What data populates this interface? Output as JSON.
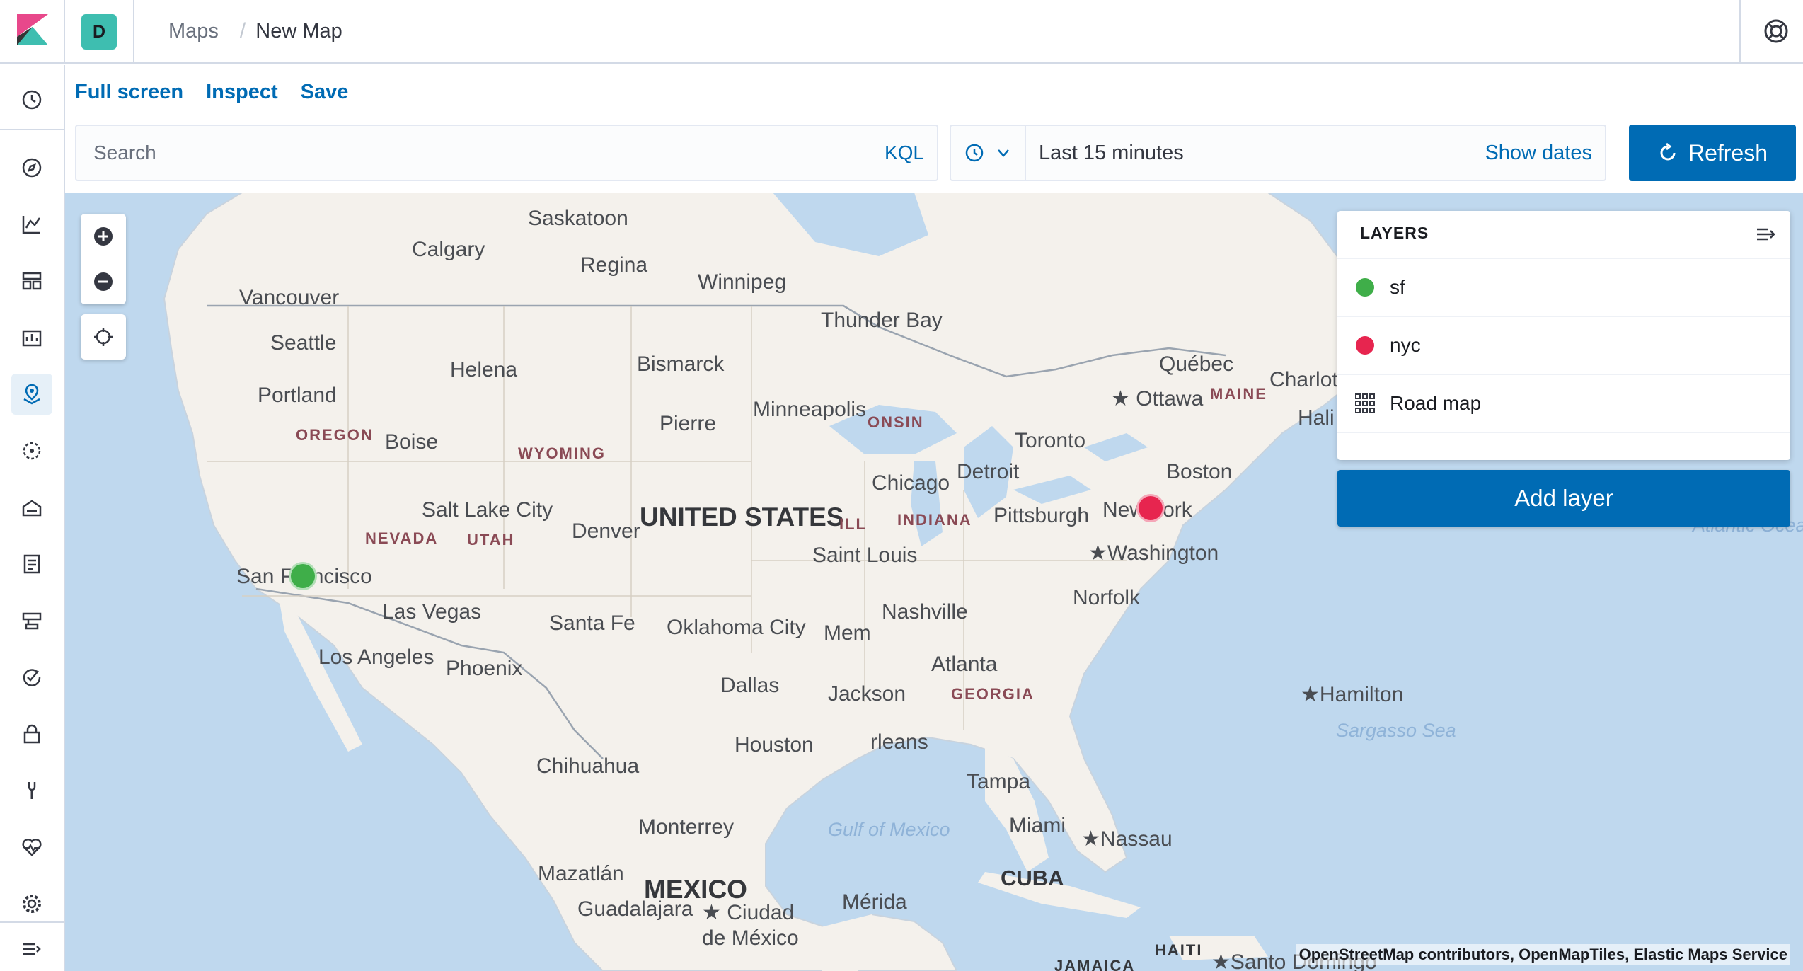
{
  "header": {
    "space_initial": "D",
    "breadcrumbs": [
      "Maps",
      "New Map"
    ],
    "breadcrumb_separator": "/"
  },
  "sidenav": {
    "items": [
      "clock-icon",
      "compass-icon",
      "visualize-icon",
      "dashboard-icon",
      "canvas-icon",
      "maps-icon",
      "ml-icon",
      "infra-icon",
      "logs-icon",
      "apm-icon",
      "uptime-icon",
      "security-icon",
      "devtools-icon",
      "monitoring-icon",
      "management-icon"
    ],
    "active_item": "maps-icon"
  },
  "topnav": {
    "full_screen": "Full screen",
    "inspect": "Inspect",
    "save": "Save"
  },
  "query": {
    "placeholder": "Search",
    "language": "KQL"
  },
  "date_picker": {
    "value": "Last 15 minutes",
    "show_dates": "Show dates"
  },
  "refresh_button": {
    "label": "Refresh"
  },
  "layers": {
    "title": "LAYERS",
    "items": [
      {
        "name": "sf",
        "color": "#3fae49",
        "icon": "circle-dot"
      },
      {
        "name": "nyc",
        "color": "#e7254f",
        "icon": "circle-dot"
      },
      {
        "name": "Road map",
        "color": "#343741",
        "icon": "grid-icon"
      }
    ],
    "add_label": "Add layer"
  },
  "map": {
    "labels": {
      "saskatoon": "Saskatoon",
      "calgary": "Calgary",
      "regina": "Regina",
      "winnipeg": "Winnipeg",
      "vancouver": "Vancouver",
      "thunder_bay": "Thunder Bay",
      "seattle": "Seattle",
      "helena": "Helena",
      "bismarck": "Bismarck",
      "quebec": "Québec",
      "charlo": "Charlot",
      "ottawa": "Ottawa",
      "maine": "MAINE",
      "portland": "Portland",
      "minneapolis": "Minneapolis",
      "pierre": "Pierre",
      "onsin": "ONSIN",
      "hali": "Hali",
      "toronto": "Toronto",
      "oregon": "OREGON",
      "boise": "Boise",
      "wyoming": "WYOMING",
      "detroit": "Detroit",
      "boston": "Boston",
      "chicago": "Chicago",
      "salt_lake": "Salt Lake City",
      "united_states": "UNITED STATES",
      "nevada": "NEVADA",
      "utah": "UTAH",
      "denver": "Denver",
      "ill": "ILL",
      "indiana": "INDIANA",
      "pittsburgh": "Pittsburgh",
      "new_york": "New York",
      "saint_louis": "Saint Louis",
      "washington": "Washington",
      "atlantic": "Atlantic Ocean",
      "san_francisco": "San Francisco",
      "norfolk": "Norfolk",
      "las_vegas": "Las Vegas",
      "nashville": "Nashville",
      "santa_fe": "Santa Fe",
      "oklahoma_city": "Oklahoma City",
      "mem": "Mem",
      "los_angeles": "Los Angeles",
      "atlanta": "Atlanta",
      "phoenix": "Phoenix",
      "dallas": "Dallas",
      "jackson": "Jackson",
      "georgia": "GEORGIA",
      "hamilton": "Hamilton",
      "sargasso": "Sargasso Sea",
      "houston": "Houston",
      "orleans": "rleans",
      "chihuahua": "Chihuahua",
      "tampa": "Tampa",
      "gulf": "Gulf of Mexico",
      "monterrey": "Monterrey",
      "miami": "Miami",
      "nassau": "Nassau",
      "mazatlan": "Mazatlán",
      "mexico": "MEXICO",
      "cuba": "CUBA",
      "guadalajara": "Guadalajara",
      "ciudad": "Ciudad de México",
      "merida": "Mérida",
      "haiti": "HAITI",
      "jamaica": "JAMAICA",
      "santo_domingo": "Santo Domingo"
    },
    "attribution": "OpenStreetMap contributors, OpenMapTiles, Elastic Maps Service"
  }
}
